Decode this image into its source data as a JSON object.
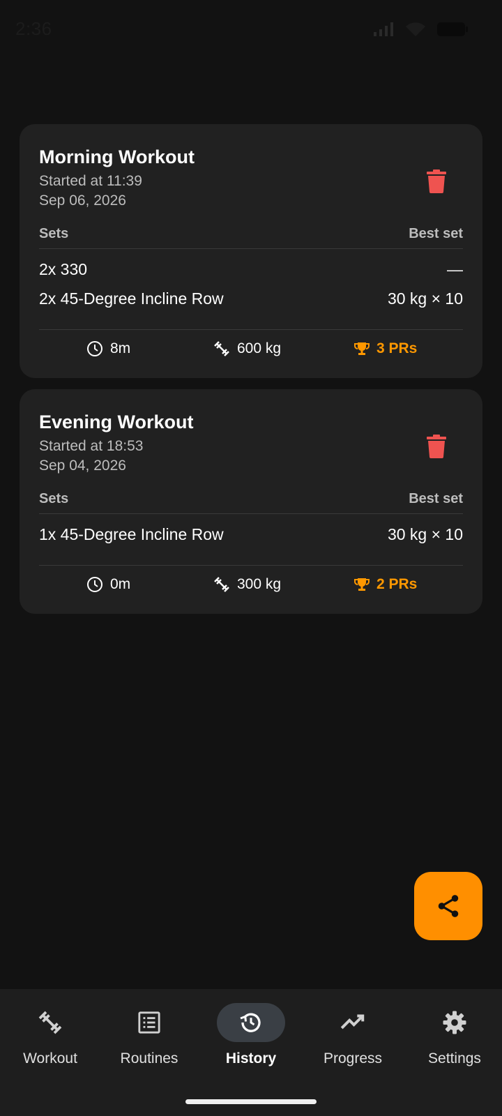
{
  "status_bar": {
    "time": "2:36"
  },
  "colors": {
    "accent": "#ff8f00",
    "pr": "#ff9800",
    "delete": "#f44336",
    "card": "#212121",
    "background": "#121212"
  },
  "workouts": [
    {
      "title": "Morning Workout",
      "started": "Started at 11:39",
      "date": "Sep 06, 2026",
      "sets_header": "Sets",
      "best_header": "Best set",
      "rows": [
        {
          "sets": "2x 330",
          "best": "—"
        },
        {
          "sets": "2x 45-Degree Incline Row",
          "best": "30 kg × 10"
        }
      ],
      "duration": "8m",
      "volume": "600 kg",
      "prs": "3 PRs"
    },
    {
      "title": "Evening Workout",
      "started": "Started at 18:53",
      "date": "Sep 04, 2026",
      "sets_header": "Sets",
      "best_header": "Best set",
      "rows": [
        {
          "sets": "1x 45-Degree Incline Row",
          "best": "30 kg × 10"
        }
      ],
      "duration": "0m",
      "volume": "300 kg",
      "prs": "2 PRs"
    }
  ],
  "fab": {
    "icon": "share-icon"
  },
  "nav": {
    "items": [
      {
        "label": "Workout",
        "icon": "dumbbell-icon"
      },
      {
        "label": "Routines",
        "icon": "list-icon"
      },
      {
        "label": "History",
        "icon": "history-icon",
        "active": true
      },
      {
        "label": "Progress",
        "icon": "trending-up-icon"
      },
      {
        "label": "Settings",
        "icon": "gear-icon"
      }
    ]
  }
}
